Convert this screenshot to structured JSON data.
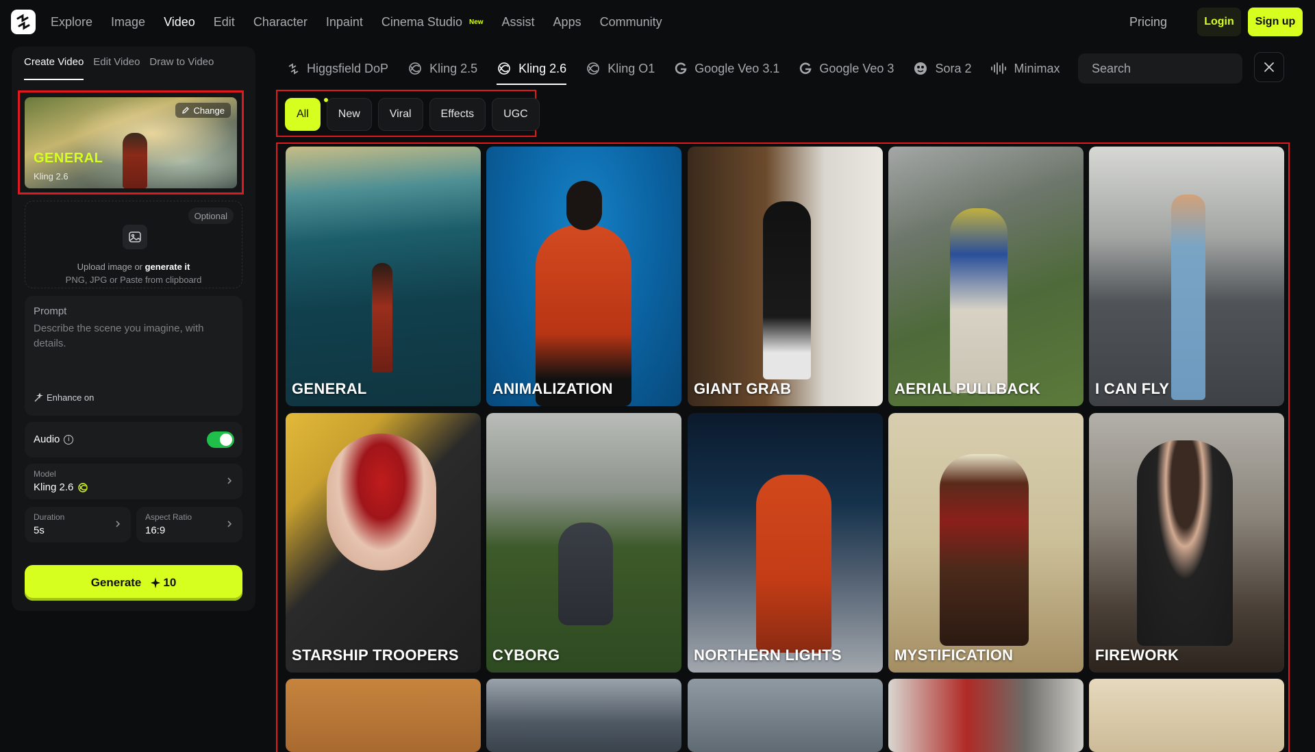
{
  "nav": {
    "links": [
      "Explore",
      "Image",
      "Video",
      "Edit",
      "Character",
      "Inpaint",
      "Cinema Studio",
      "Assist",
      "Apps",
      "Community"
    ],
    "new_badge": "New",
    "pricing": "Pricing",
    "login": "Login",
    "signup": "Sign up"
  },
  "left": {
    "subtabs": [
      "Create Video",
      "Edit Video",
      "Draw to Video"
    ],
    "preset": {
      "title": "GENERAL",
      "model": "Kling 2.6",
      "change": "Change"
    },
    "upload": {
      "optional": "Optional",
      "line1_prefix": "Upload image or ",
      "line1_bold": "generate it",
      "line2": "PNG, JPG or Paste from clipboard"
    },
    "prompt": {
      "label": "Prompt",
      "placeholder": "Describe the scene you imagine, with details.",
      "enhance": "Enhance on"
    },
    "audio": {
      "label": "Audio",
      "on": true
    },
    "model": {
      "label": "Model",
      "value": "Kling 2.6"
    },
    "duration": {
      "label": "Duration",
      "value": "5s"
    },
    "aspect": {
      "label": "Aspect Ratio",
      "value": "16:9"
    },
    "generate": {
      "label": "Generate",
      "cost": "10"
    }
  },
  "model_tabs": [
    "Higgsfield DoP",
    "Kling 2.5",
    "Kling 2.6",
    "Kling O1",
    "Google Veo 3.1",
    "Google Veo 3",
    "Sora 2",
    "Minimax"
  ],
  "search": {
    "placeholder": "Search"
  },
  "chips": [
    "All",
    "New",
    "Viral",
    "Effects",
    "UGC"
  ],
  "cards": [
    "GENERAL",
    "ANIMALIZATION",
    "GIANT GRAB",
    "AERIAL PULLBACK",
    "I CAN FLY",
    "STARSHIP TROOPERS",
    "CYBORG",
    "NORTHERN LIGHTS",
    "MYSTIFICATION",
    "FIREWORK",
    "",
    "",
    "",
    "",
    ""
  ],
  "colors": {
    "accent": "#d6ff1f",
    "highlight": "#e0191e",
    "toggle": "#1fbf4a"
  }
}
